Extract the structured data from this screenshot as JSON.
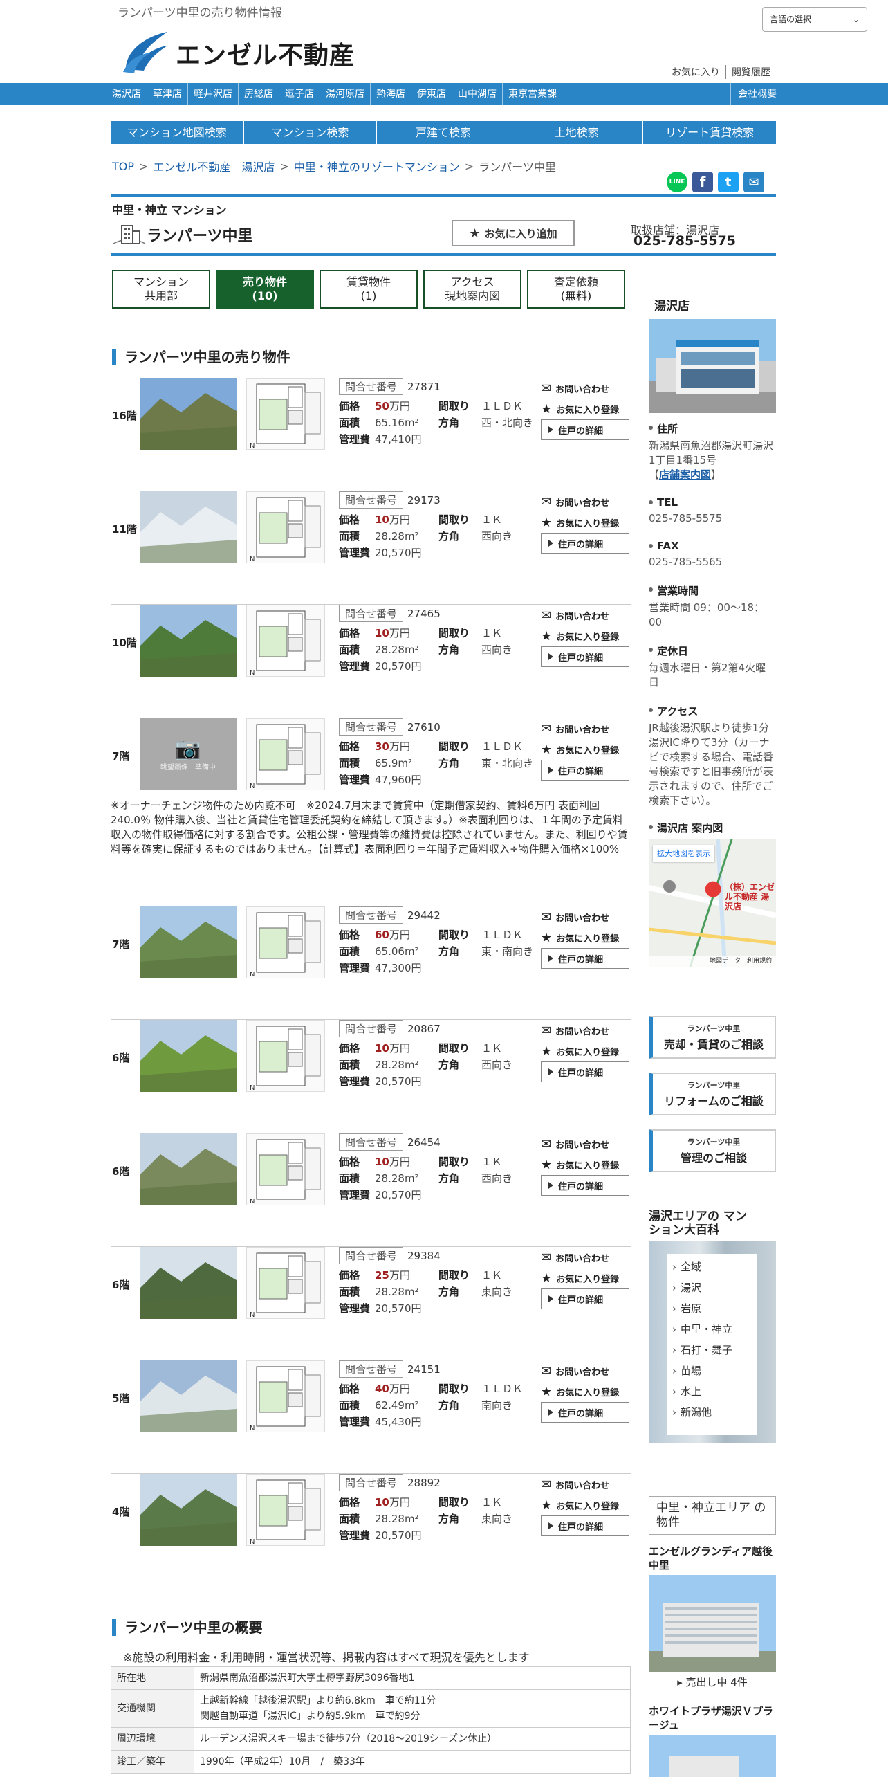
{
  "header": {
    "tagline": "ランパーツ中里の売り物件情報",
    "lang_select": "言語の選択",
    "logo_text": "エンゼル不動産",
    "links": [
      "お気に入り",
      "閲覧履歴"
    ]
  },
  "navbar": {
    "items": [
      "湯沢店",
      "草津店",
      "軽井沢店",
      "房総店",
      "逗子店",
      "湯河原店",
      "熱海店",
      "伊東店",
      "山中湖店",
      "東京営業課"
    ],
    "right": "会社概要"
  },
  "search_tabs": [
    "マンション地図検索",
    "マンション検索",
    "戸建て検索",
    "土地検索",
    "リゾート賃貸検索"
  ],
  "breadcrumb": [
    "TOP",
    "エンゼル不動産　湯沢店",
    "中里・神立のリゾートマンション",
    "ランパーツ中里"
  ],
  "share": {
    "line": "LINE",
    "facebook": "f",
    "twitter": "t",
    "mail": "✉"
  },
  "property": {
    "category": "中里・神立 マンション",
    "name": "ランパーツ中里",
    "fav_button": "お気に入り追加",
    "store_label": "取扱店舗：湯沢店",
    "store_tel": "025-785-5575"
  },
  "tabs": [
    {
      "l1": "マンション",
      "l2": "共用部"
    },
    {
      "l1": "売り物件",
      "l2": "(10)"
    },
    {
      "l1": "賃貸物件",
      "l2": "(1)"
    },
    {
      "l1": "アクセス",
      "l2": "現地案内図"
    },
    {
      "l1": "査定依頼",
      "l2": "(無料)"
    }
  ],
  "sale_section_title": "ランパーツ中里の売り物件",
  "labels": {
    "inquiry": "問合せ番号",
    "price": "価格",
    "layout": "間取り",
    "area": "面積",
    "direction": "方角",
    "fee": "管理費",
    "contact": "お問い合わせ",
    "fav": "お気に入り登録",
    "detail": "住戸の詳細",
    "unit": "万円",
    "no_photo": "眺望画像　準備中"
  },
  "listings": [
    {
      "floor": "16階",
      "no": "27871",
      "price": "50",
      "layout": "１ＬＤＫ",
      "area": "65.16m²",
      "dir": "西・北向き",
      "fee": "47,410円"
    },
    {
      "floor": "11階",
      "no": "29173",
      "price": "10",
      "layout": "１Ｋ",
      "area": "28.28m²",
      "dir": "西向き",
      "fee": "20,570円"
    },
    {
      "floor": "10階",
      "no": "27465",
      "price": "10",
      "layout": "１Ｋ",
      "area": "28.28m²",
      "dir": "西向き",
      "fee": "20,570円"
    },
    {
      "floor": "7階",
      "no": "27610",
      "price": "30",
      "layout": "１ＬＤＫ",
      "area": "65.9m²",
      "dir": "東・北向き",
      "fee": "47,960円"
    },
    {
      "floor": "7階",
      "no": "29442",
      "price": "60",
      "layout": "１ＬＤＫ",
      "area": "65.06m²",
      "dir": "東・南向き",
      "fee": "47,300円"
    },
    {
      "floor": "6階",
      "no": "20867",
      "price": "10",
      "layout": "１Ｋ",
      "area": "28.28m²",
      "dir": "西向き",
      "fee": "20,570円"
    },
    {
      "floor": "6階",
      "no": "26454",
      "price": "10",
      "layout": "１Ｋ",
      "area": "28.28m²",
      "dir": "西向き",
      "fee": "20,570円"
    },
    {
      "floor": "6階",
      "no": "29384",
      "price": "25",
      "layout": "１Ｋ",
      "area": "28.28m²",
      "dir": "東向き",
      "fee": "20,570円"
    },
    {
      "floor": "5階",
      "no": "24151",
      "price": "40",
      "layout": "１ＬＤＫ",
      "area": "62.49m²",
      "dir": "南向き",
      "fee": "45,430円"
    },
    {
      "floor": "4階",
      "no": "28892",
      "price": "10",
      "layout": "１Ｋ",
      "area": "28.28m²",
      "dir": "東向き",
      "fee": "20,570円"
    }
  ],
  "listing_note": "※オーナーチェンジ物件のため内覧不可　※2024.7月末まで賃貸中（定期借家契約、賃料6万円 表面利回240.0％ 物件購入後、当社と賃貸住宅管理委託契約を締結して頂きます。）※表面利回りは、１年間の予定賃料収入の物件取得価格に対する割合です。公租公課・管理費等の維持費は控除されていません。また、利回りや賃料等を確実に保証するものではありません。【計算式】表面利回り＝年間予定賃料収入÷物件購入価格×100%",
  "overview": {
    "title": "ランパーツ中里の概要",
    "note": "※施設の利用料金・利用時間・運営状況等、掲載内容はすべて現況を優先とします",
    "rows": [
      {
        "k": "所在地",
        "v": "新潟県南魚沼郡湯沢町大字土樽字野尻3096番地1"
      },
      {
        "k": "交通機関",
        "v": "上越新幹線「越後湯沢駅」より約6.8km　車で約11分",
        "v2": "関越自動車道「湯沢IC」より約5.9km　車で約9分"
      },
      {
        "k": "周辺環境",
        "v": "ルーデンス湯沢スキー場まで徒歩7分（2018～2019シーズン休止）"
      },
      {
        "k": "竣工／築年",
        "v": "1990年（平成2年）10月　/　築33年"
      }
    ]
  },
  "sidebar": {
    "store_title": "湯沢店",
    "addr_label": "住所",
    "addr": "新潟県南魚沼郡湯沢町湯沢1丁目1番15号",
    "addr_link": "店舗案内図",
    "tel_label": "TEL",
    "tel": "025-785-5575",
    "fax_label": "FAX",
    "fax": "025-785-5565",
    "hours_label": "営業時間",
    "hours": "営業時間 09：00～18：00",
    "closed_label": "定休日",
    "closed": "毎週水曜日・第2第4火曜日",
    "access_label": "アクセス",
    "access": "JR越後湯沢駅より徒歩1分　湯沢IC降りて3分（カーナビで検索する場合、電話番号検索ですと旧事務所が表示されますので、住所でご検索下さい）。",
    "map_title": "湯沢店 案内図",
    "map_button": "拡大地図を表示",
    "map_pin": "（株）エンゼル不動産 湯沢店",
    "map_footer": "地図データ　利用規約",
    "consult": [
      {
        "sm": "ランパーツ中里",
        "lg": "売却・賃貸のご相談"
      },
      {
        "sm": "ランパーツ中里",
        "lg": "リフォームのご相談"
      },
      {
        "sm": "ランパーツ中里",
        "lg": "管理のご相談"
      }
    ],
    "encyclopedia_title": "湯沢エリアの マンション大百科",
    "areas": [
      "全域",
      "湯沢",
      "岩原",
      "中里・神立",
      "石打・舞子",
      "苗場",
      "水上",
      "新潟他"
    ],
    "area_box_title": "中里・神立エリア の物件",
    "props": [
      {
        "name": "エンゼルグランディア越後中里",
        "caption": "売出し中 4件"
      },
      {
        "name": "ホワイトプラザ湯沢Ｖプラージュ"
      }
    ]
  }
}
